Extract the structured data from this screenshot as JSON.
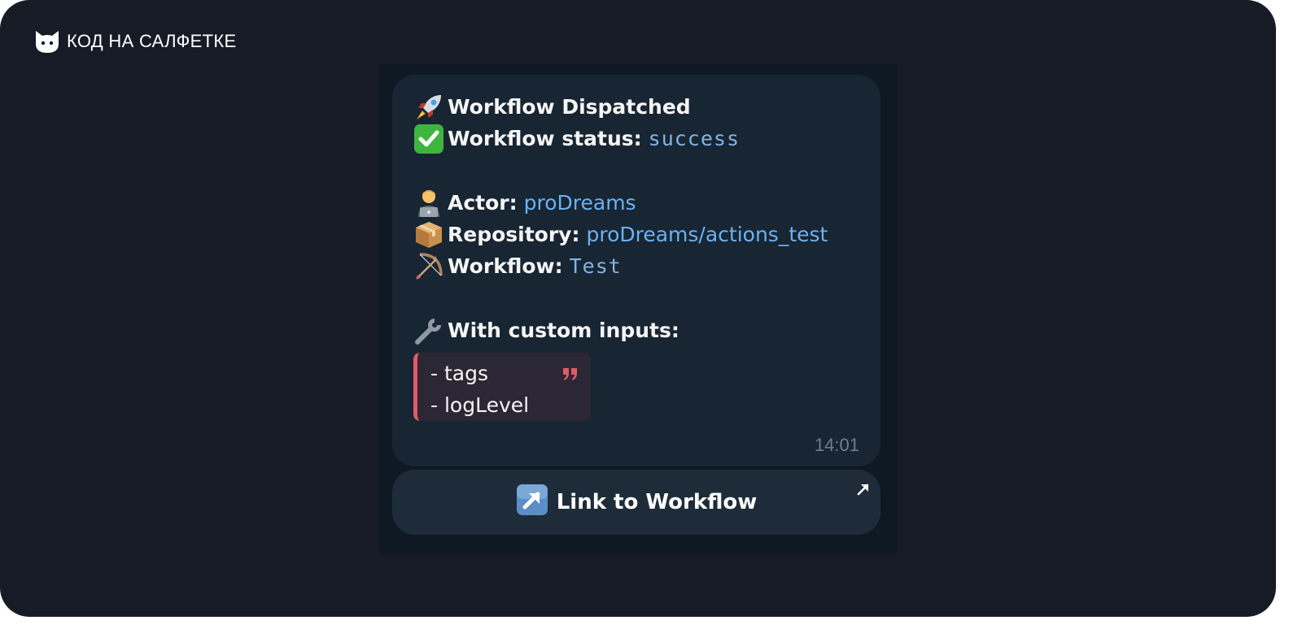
{
  "brand": {
    "name": "КОД НА САЛФЕТКЕ",
    "icon": "cat-head-icon"
  },
  "message": {
    "lines": {
      "dispatched": {
        "icon": "rocket-icon",
        "text": "Workflow Dispatched"
      },
      "status": {
        "icon": "check-mark-icon",
        "label": "Workflow status:",
        "value": "success"
      },
      "actor": {
        "icon": "technologist-icon",
        "label": "Actor:",
        "value": "proDreams"
      },
      "repository": {
        "icon": "package-icon",
        "label": "Repository:",
        "value": "proDreams/actions_test"
      },
      "workflow": {
        "icon": "bow-and-arrow-icon",
        "label": "Workflow:",
        "value": "Test"
      },
      "inputs": {
        "icon": "wrench-icon",
        "label": "With custom inputs:"
      }
    },
    "quote": {
      "lines": [
        "- tags",
        "- logLevel"
      ],
      "icon": "quote-icon"
    },
    "time": "14:01"
  },
  "button": {
    "label": "Link to Workflow",
    "icon": "up-right-arrow-icon",
    "corner_icon": "external-link-arrow-icon"
  },
  "colors": {
    "background": "#161b26",
    "bubble": "#182533",
    "link": "#6ab2f2",
    "quote_bar": "#e05a67"
  }
}
